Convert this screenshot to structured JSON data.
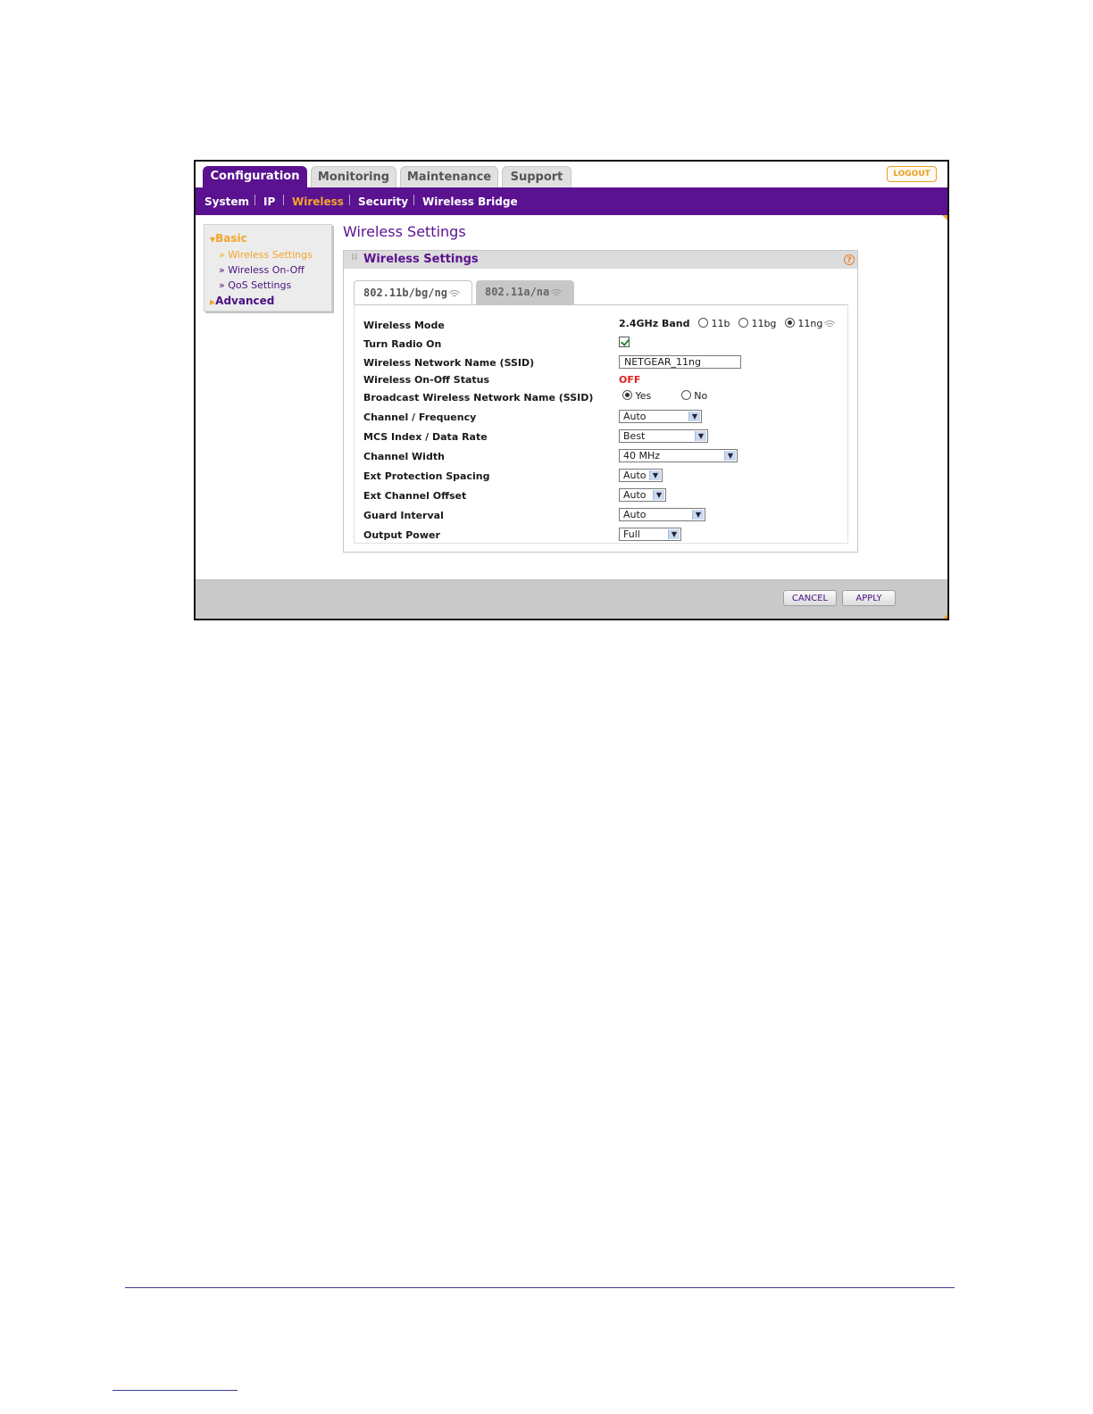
{
  "tabs": {
    "configuration": "Configuration",
    "monitoring": "Monitoring",
    "maintenance": "Maintenance",
    "support": "Support",
    "logout": "LOGOUT"
  },
  "subnav": {
    "system": "System",
    "ip": "IP",
    "wireless": "Wireless",
    "security": "Security",
    "wireless_bridge": "Wireless Bridge"
  },
  "sidebar": {
    "basic": "Basic",
    "wireless_settings": "» Wireless Settings",
    "wireless_on_off": "» Wireless On-Off",
    "qos_settings": "» QoS Settings",
    "advanced": "Advanced"
  },
  "page_title": "Wireless Settings",
  "panel": {
    "title": "Wireless Settings",
    "help": "?",
    "tab_bgng": "802.11b/bg/ng",
    "tab_ana": "802.11a/na"
  },
  "form": {
    "wireless_mode": {
      "label": "Wireless Mode",
      "band": "2.4GHz Band",
      "options": [
        "11b",
        "11bg",
        "11ng"
      ],
      "selected": "11ng"
    },
    "turn_radio_on": {
      "label": "Turn Radio On",
      "checked": true
    },
    "ssid": {
      "label": "Wireless Network Name (SSID)",
      "value": "NETGEAR_11ng"
    },
    "on_off_status": {
      "label": "Wireless On-Off Status",
      "value": "OFF"
    },
    "broadcast": {
      "label": "Broadcast Wireless Network Name (SSID)",
      "yes": "Yes",
      "no": "No",
      "selected": "Yes"
    },
    "channel": {
      "label": "Channel / Frequency",
      "value": "Auto"
    },
    "mcs": {
      "label": "MCS Index / Data Rate",
      "value": "Best"
    },
    "channel_width": {
      "label": "Channel Width",
      "value": "40 MHz"
    },
    "ext_protection": {
      "label": "Ext Protection Spacing",
      "value": "Auto"
    },
    "ext_channel": {
      "label": "Ext Channel Offset",
      "value": "Auto"
    },
    "guard_interval": {
      "label": "Guard Interval",
      "value": "Auto"
    },
    "output_power": {
      "label": "Output Power",
      "value": "Full"
    }
  },
  "buttons": {
    "cancel": "CANCEL",
    "apply": "APPLY"
  },
  "colors": {
    "brand_purple": "#5a1290",
    "accent_orange": "#f3a52b",
    "status_red": "#e02020"
  }
}
